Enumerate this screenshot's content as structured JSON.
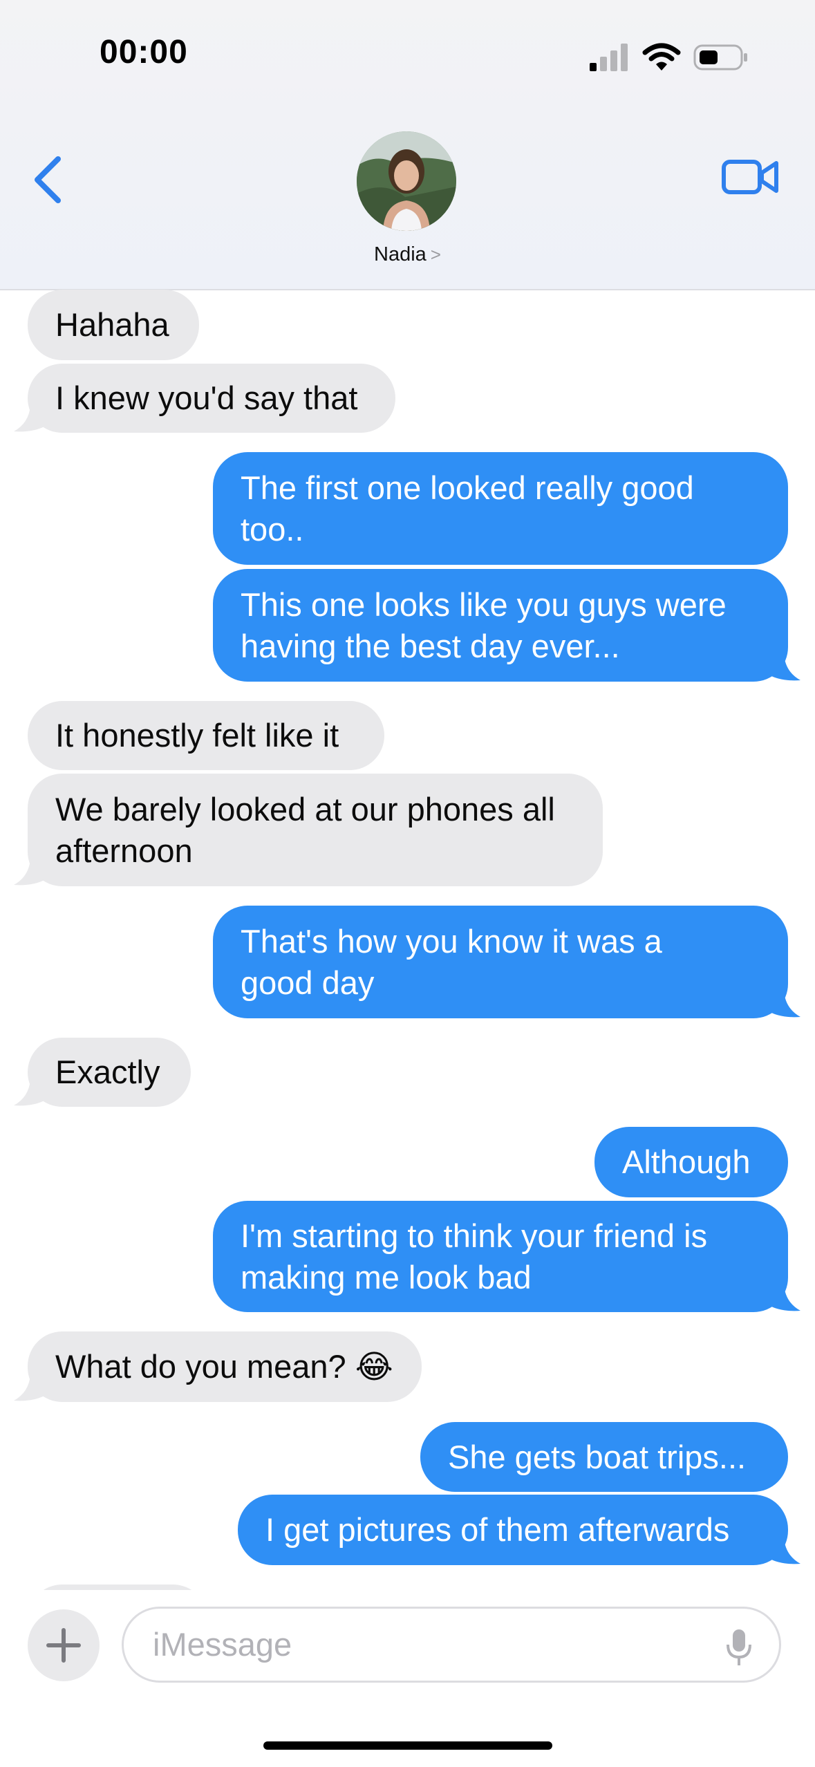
{
  "status_bar": {
    "time": "00:00"
  },
  "header": {
    "contact_name": "Nadia",
    "name_chevron": ">"
  },
  "messages": [
    {
      "dir": "in",
      "lines": [
        "Hahaha"
      ]
    },
    {
      "dir": "in",
      "lines": [
        "I knew you'd say that"
      ]
    },
    {
      "dir": "out",
      "lines": [
        "The first one looked really good",
        "too.."
      ]
    },
    {
      "dir": "out",
      "lines": [
        "This one looks like you guys were",
        "having the best day ever..."
      ]
    },
    {
      "dir": "in",
      "lines": [
        "It honestly felt like it"
      ]
    },
    {
      "dir": "in",
      "lines": [
        "We barely looked at our phones all",
        "afternoon"
      ]
    },
    {
      "dir": "out",
      "lines": [
        "That's how you know it was a",
        "good day"
      ]
    },
    {
      "dir": "in",
      "lines": [
        "Exactly"
      ]
    },
    {
      "dir": "out",
      "lines": [
        "Although"
      ]
    },
    {
      "dir": "out",
      "lines": [
        "I'm starting to think your friend is",
        "making me look bad"
      ]
    },
    {
      "dir": "in",
      "lines": [
        "What do you mean? 😂"
      ]
    },
    {
      "dir": "out",
      "lines": [
        "She gets boat trips..."
      ]
    },
    {
      "dir": "out",
      "lines": [
        "I get pictures of them afterwards"
      ]
    }
  ],
  "input": {
    "placeholder": "iMessage"
  },
  "colors": {
    "outgoing": "#2f8ff5",
    "incoming": "#e9e9eb",
    "accent": "#2f80ed"
  },
  "icons": [
    "chevron-left-icon",
    "video-camera-icon",
    "plus-icon",
    "microphone-icon",
    "signal-icon",
    "wifi-icon",
    "battery-icon"
  ]
}
